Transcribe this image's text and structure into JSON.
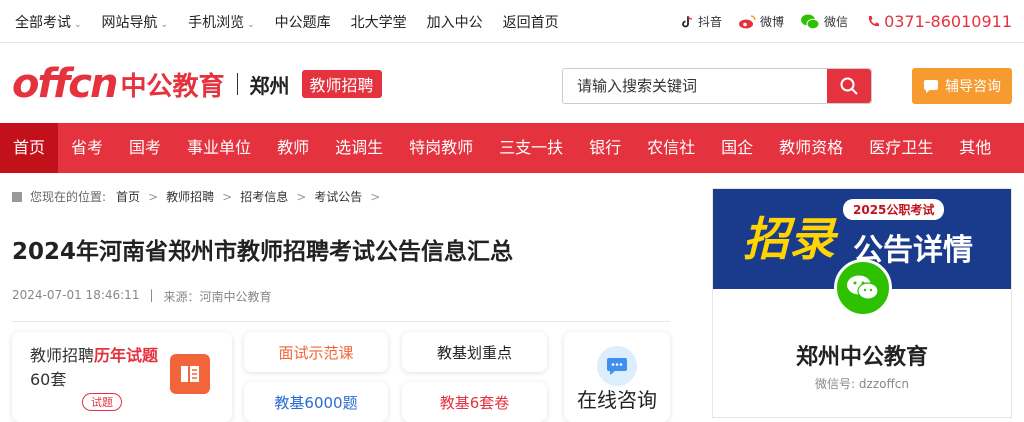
{
  "topbar": {
    "left_items": [
      "全部考试",
      "网站导航",
      "手机浏览",
      "中公题库",
      "北大学堂",
      "加入中公",
      "返回首页"
    ],
    "social": [
      "抖音",
      "微博",
      "微信"
    ],
    "phone": "0371-86010911"
  },
  "header": {
    "logo_en": "offcn",
    "logo_cn": "中公教育",
    "city": "郑州",
    "badge": "教师招聘",
    "search_placeholder": "请输入搜索关键词",
    "consult_label": "辅导咨询"
  },
  "nav": [
    "首页",
    "省考",
    "国考",
    "事业单位",
    "教师",
    "选调生",
    "特岗教师",
    "三支一扶",
    "银行",
    "农信社",
    "国企",
    "教师资格",
    "医疗卫生",
    "其他"
  ],
  "breadcrumb": {
    "label": "您现在的位置:",
    "items": [
      "首页",
      "教师招聘",
      "招考信息",
      "考试公告"
    ]
  },
  "article": {
    "title": "2024年河南省郑州市教师招聘考试公告信息汇总",
    "date": "2024-07-01 18:46:11",
    "source": "来源：河南中公教育"
  },
  "cards": {
    "c1_a": "教师招聘",
    "c1_b": "历年试题",
    "c1_c": "60套",
    "c1_d": "试题",
    "c2": "面试示范课",
    "c3": "教基划重点",
    "c4": "在线咨询",
    "c5": "教基6000题",
    "c6": "教基6套卷"
  },
  "sidebar": {
    "banner_big": "招录",
    "banner_text": "公告详情",
    "banner_tag": "2025公职考试",
    "name": "郑州中公教育",
    "wechat": "微信号:  dzzoffcn"
  },
  "colors": {
    "brand": "#e5323f",
    "nav_active": "#c3111c",
    "consult": "#f79a2f"
  }
}
